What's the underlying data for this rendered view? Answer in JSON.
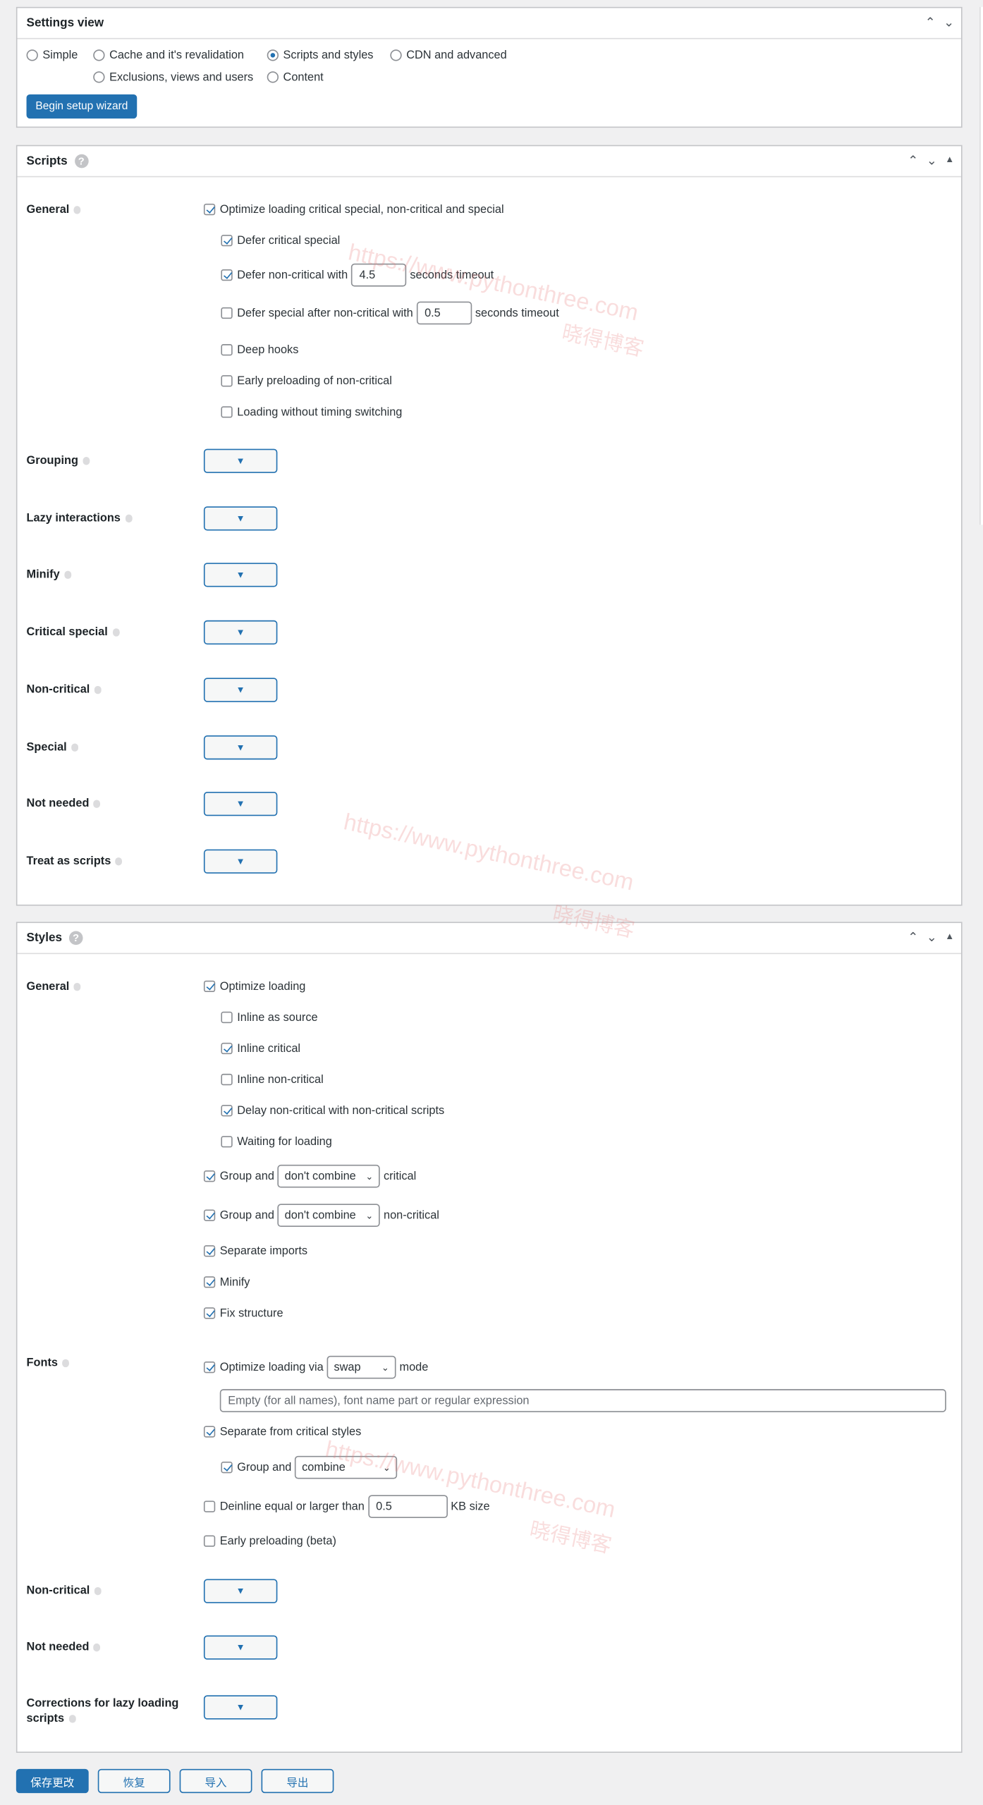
{
  "settings_view": {
    "title": "Settings view",
    "options": [
      {
        "label": "Simple",
        "checked": false
      },
      {
        "label": "Cache and it's revalidation",
        "checked": false
      },
      {
        "label": "Scripts and styles",
        "checked": true
      },
      {
        "label": "CDN and advanced",
        "checked": false
      },
      {
        "label": "Exclusions, views and users",
        "checked": false
      },
      {
        "label": "Content",
        "checked": false
      }
    ],
    "wizard_button": "Begin setup wizard"
  },
  "scripts": {
    "title": "Scripts",
    "general_label": "General",
    "optimize": "Optimize loading critical special, non-critical and special",
    "defer_critical": "Defer critical special",
    "defer_noncritical_pre": "Defer non-critical with",
    "defer_noncritical_value": "4.5",
    "defer_noncritical_post": "seconds timeout",
    "defer_special_pre": "Defer special after non-critical with",
    "defer_special_value": "0.5",
    "defer_special_post": "seconds timeout",
    "deep_hooks": "Deep hooks",
    "early_preloading": "Early preloading of non-critical",
    "loading_without_timing": "Loading without timing switching",
    "rows": [
      "Grouping",
      "Lazy interactions",
      "Minify",
      "Critical special",
      "Non-critical",
      "Special",
      "Not needed",
      "Treat as scripts"
    ]
  },
  "styles": {
    "title": "Styles",
    "general_label": "General",
    "optimize": "Optimize loading",
    "inline_source": "Inline as source",
    "inline_critical": "Inline critical",
    "inline_noncritical": "Inline non-critical",
    "delay_noncritical": "Delay non-critical with non-critical scripts",
    "waiting": "Waiting for loading",
    "group_and": "Group and",
    "group_critical_value": "don't combine",
    "group_critical_post": "critical",
    "group_noncritical_value": "don't combine",
    "group_noncritical_post": "non-critical",
    "separate_imports": "Separate imports",
    "minify": "Minify",
    "fix_structure": "Fix structure",
    "fonts_label": "Fonts",
    "fonts_optimize_pre": "Optimize loading via",
    "fonts_mode_value": "swap",
    "fonts_optimize_post": "mode",
    "fonts_names_placeholder": "Empty (for all names), font name part or regular expression",
    "fonts_separate": "Separate from critical styles",
    "fonts_group_value": "combine",
    "deinline_pre": "Deinline equal or larger than",
    "deinline_value": "0.5",
    "deinline_post": "KB size",
    "early_preloading": "Early preloading (beta)",
    "rows": [
      "Non-critical",
      "Not needed",
      "Corrections for lazy loading scripts"
    ]
  },
  "footer": {
    "save": "保存更改",
    "restore": "恢复",
    "import": "导入",
    "export": "导出"
  },
  "watermark": {
    "url": "https://www.pythonthree.com",
    "name": "晓得博客"
  },
  "colors": {
    "accent": "#2271b1",
    "background": "#f0f0f1"
  }
}
